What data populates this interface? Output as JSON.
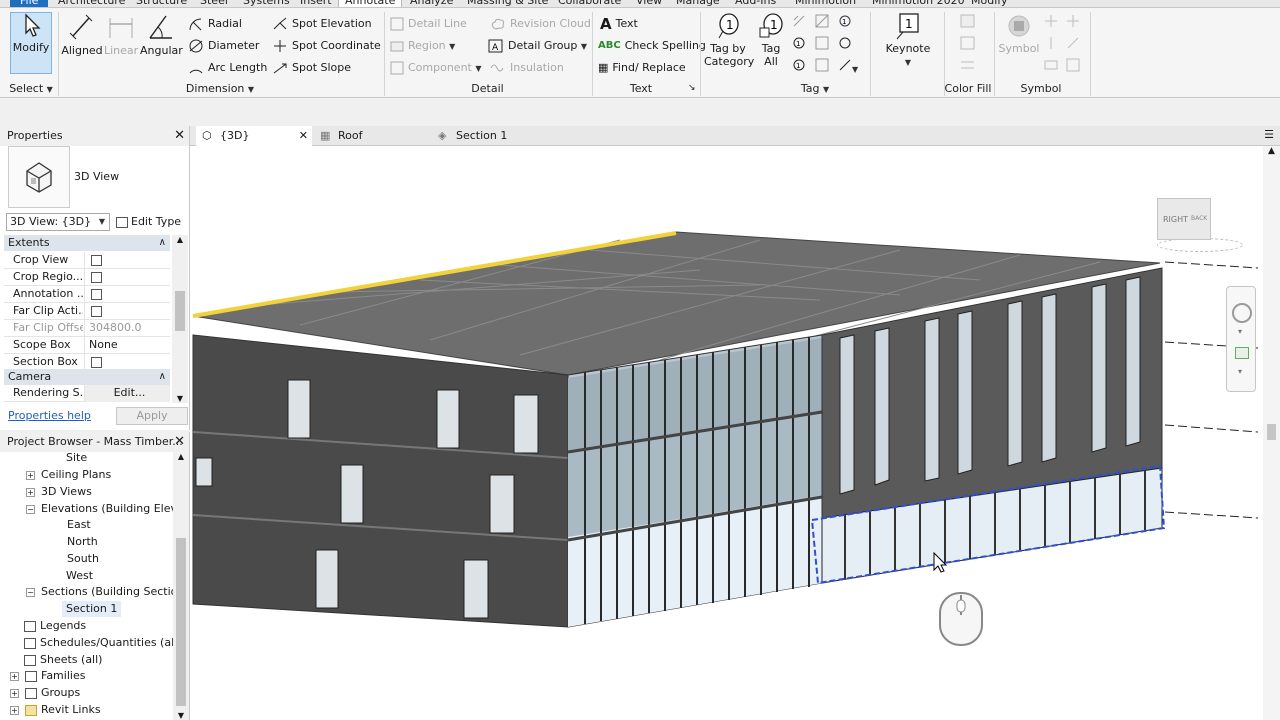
{
  "ribbon_tabs": [
    "File",
    "Architecture",
    "Structure",
    "Steel",
    "Systems",
    "Insert",
    "Annotate",
    "Analyze",
    "Massing & Site",
    "Collaborate",
    "View",
    "Manage",
    "Add-Ins",
    "Minimotion",
    "Minimotion 2020",
    "Modify"
  ],
  "active_ribbon_tab": "Annotate",
  "ribbon": {
    "select": {
      "modify": "Modify",
      "panel": "Select"
    },
    "dimension": {
      "aligned": "Aligned",
      "linear": "Linear",
      "angular": "Angular",
      "radial": "Radial",
      "diameter": "Diameter",
      "arc_length": "Arc  Length",
      "spot_elevation": "Spot Elevation",
      "spot_coordinate": "Spot Coordinate",
      "spot_slope": "Spot Slope",
      "panel": "Dimension"
    },
    "detail": {
      "detail_line": "Detail Line",
      "region": "Region",
      "component": "Component",
      "revision_cloud": "Revision Cloud",
      "detail_group": "Detail Group",
      "insulation": "Insulation",
      "panel": "Detail"
    },
    "text": {
      "text": "Text",
      "check_spelling": "Check  Spelling",
      "find_replace": "Find/  Replace",
      "panel": "Text"
    },
    "tag": {
      "tag_by_category": "Tag by\nCategory",
      "tag_all": "Tag\nAll",
      "panel": "Tag"
    },
    "keynote": {
      "keynote": "Keynote"
    },
    "color_fill": {
      "panel": "Color Fill"
    },
    "symbol": {
      "symbol": "Symbol",
      "panel": "Symbol"
    }
  },
  "properties": {
    "title": "Properties",
    "type_name": "3D View",
    "view_selector": "3D View: {3D}",
    "edit_type": "Edit Type",
    "categories": {
      "extents": "Extents",
      "camera": "Camera"
    },
    "rows": [
      {
        "label": "Crop View",
        "value": ""
      },
      {
        "label": "Crop Regio...",
        "value": ""
      },
      {
        "label": "Annotation ...",
        "value": ""
      },
      {
        "label": "Far Clip Acti...",
        "value": ""
      },
      {
        "label": "Far Clip Offset",
        "value": "304800.0"
      },
      {
        "label": "Scope Box",
        "value": "None"
      },
      {
        "label": "Section Box",
        "value": ""
      },
      {
        "label": "Rendering S...",
        "value": "Edit..."
      }
    ],
    "help": "Properties help",
    "apply": "Apply"
  },
  "browser": {
    "title": "Project Browser - Mass Timber...",
    "items": [
      "Site",
      "Ceiling Plans",
      "3D Views",
      "Elevations (Building Eleva",
      "East",
      "North",
      "South",
      "West",
      "Sections (Building Section",
      "Section 1",
      "Legends",
      "Schedules/Quantities (all)",
      "Sheets (all)",
      "Families",
      "Groups",
      "Revit Links"
    ]
  },
  "view_tabs": [
    {
      "label": "{3D}"
    },
    {
      "label": "Roof"
    },
    {
      "label": "Section 1"
    }
  ],
  "viewcube": {
    "right": "RIGHT",
    "back": "BACK"
  },
  "colors": {
    "file_tab": "#1e6fc0",
    "selection": "#2f4fd0",
    "roof_edge": "#f2d23a",
    "link": "#1f5fbf",
    "active_tool": "#cde4f7"
  }
}
